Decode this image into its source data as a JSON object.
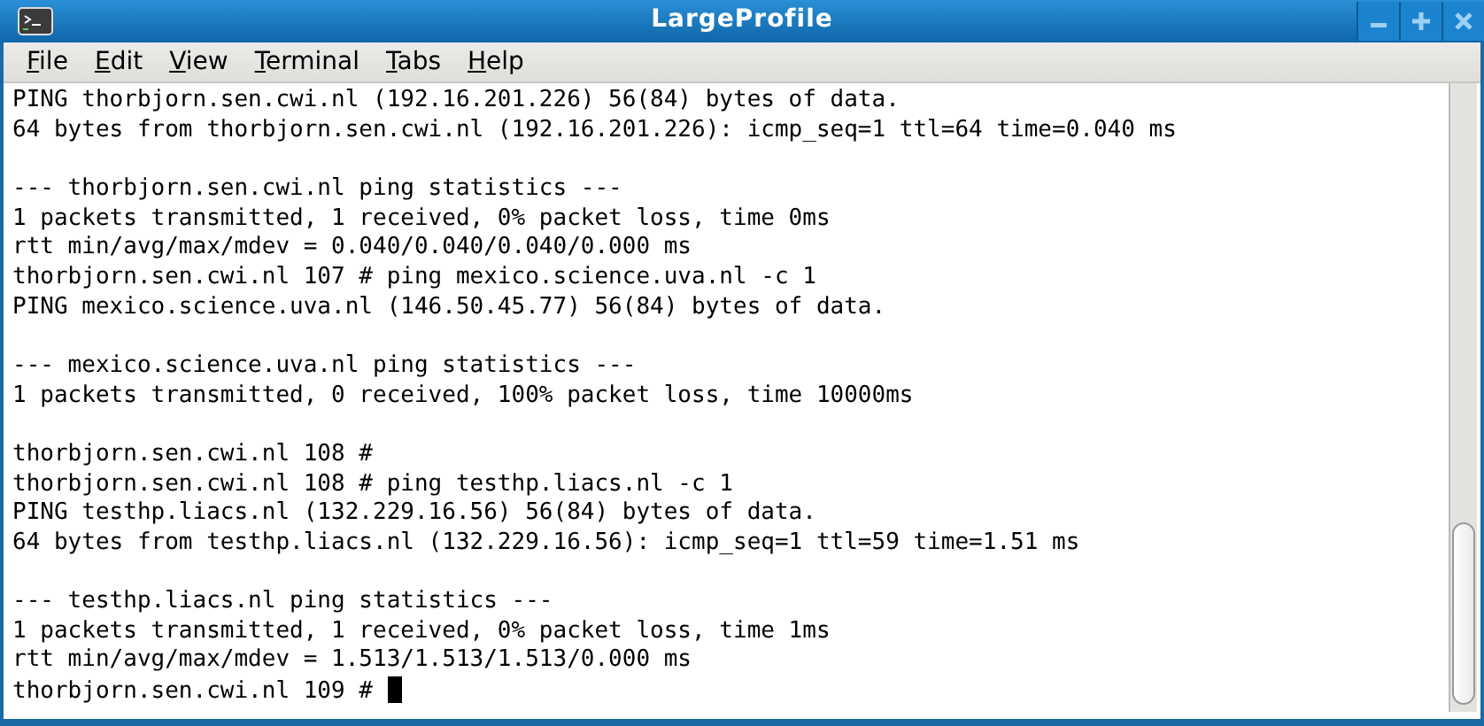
{
  "window": {
    "title": "LargeProfile"
  },
  "menu": [
    "File",
    "Edit",
    "View",
    "Terminal",
    "Tabs",
    "Help"
  ],
  "terminal": {
    "cursor": true,
    "lines": [
      {
        "kind": "text",
        "text": "PING thorbjorn.sen.cwi.nl (192.16.201.226) 56(84) bytes of data."
      },
      {
        "kind": "text",
        "text": "64 bytes from thorbjorn.sen.cwi.nl (192.16.201.226): icmp_seq=1 ttl=64 time=0.040 ms"
      },
      {
        "kind": "blank"
      },
      {
        "kind": "text",
        "text": "--- thorbjorn.sen.cwi.nl ping statistics ---"
      },
      {
        "kind": "text",
        "text": "1 packets transmitted, 1 received, 0% packet loss, time 0ms"
      },
      {
        "kind": "text",
        "text": "rtt min/avg/max/mdev = 0.040/0.040/0.040/0.000 ms"
      },
      {
        "kind": "text",
        "text": "thorbjorn.sen.cwi.nl 107 # ping mexico.science.uva.nl -c 1"
      },
      {
        "kind": "text",
        "text": "PING mexico.science.uva.nl (146.50.45.77) 56(84) bytes of data."
      },
      {
        "kind": "blank"
      },
      {
        "kind": "text",
        "text": "--- mexico.science.uva.nl ping statistics ---"
      },
      {
        "kind": "text",
        "text": "1 packets transmitted, 0 received, 100% packet loss, time 10000ms"
      },
      {
        "kind": "blank"
      },
      {
        "kind": "text",
        "text": "thorbjorn.sen.cwi.nl 108 #"
      },
      {
        "kind": "text",
        "text": "thorbjorn.sen.cwi.nl 108 # ping testhp.liacs.nl -c 1"
      },
      {
        "kind": "text",
        "text": "PING testhp.liacs.nl (132.229.16.56) 56(84) bytes of data."
      },
      {
        "kind": "text",
        "text": "64 bytes from testhp.liacs.nl (132.229.16.56): icmp_seq=1 ttl=59 time=1.51 ms"
      },
      {
        "kind": "blank"
      },
      {
        "kind": "text",
        "text": "--- testhp.liacs.nl ping statistics ---"
      },
      {
        "kind": "text",
        "text": "1 packets transmitted, 1 received, 0% packet loss, time 1ms"
      },
      {
        "kind": "text",
        "text": "rtt min/avg/max/mdev = 1.513/1.513/1.513/0.000 ms"
      },
      {
        "kind": "text",
        "text": "thorbjorn.sen.cwi.nl 109 #"
      }
    ]
  }
}
